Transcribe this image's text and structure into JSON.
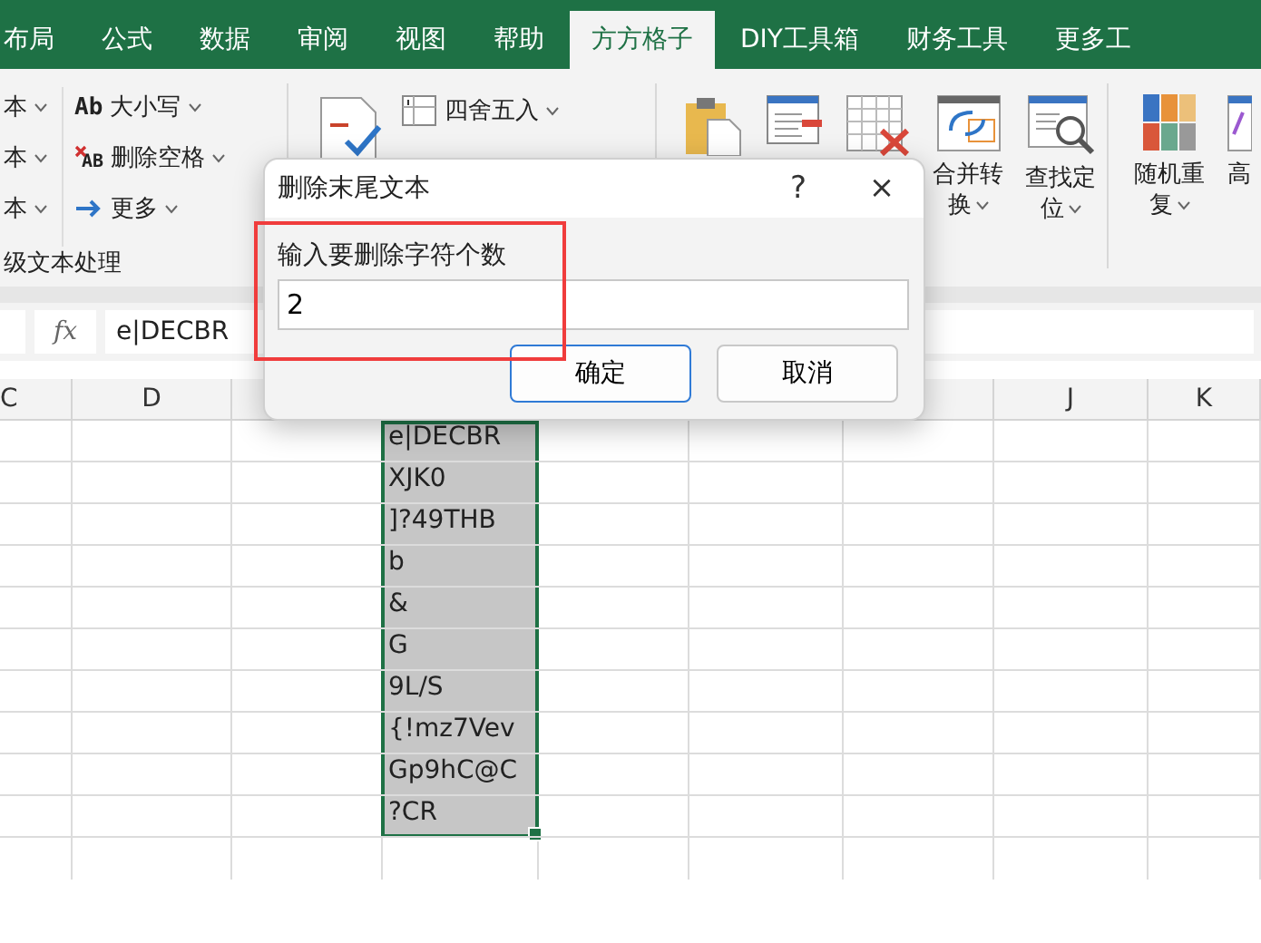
{
  "tabs": [
    {
      "label": "布局",
      "selected": false
    },
    {
      "label": "公式",
      "selected": false
    },
    {
      "label": "数据",
      "selected": false
    },
    {
      "label": "审阅",
      "selected": false
    },
    {
      "label": "视图",
      "selected": false
    },
    {
      "label": "帮助",
      "selected": false
    },
    {
      "label": "方方格子",
      "selected": true
    },
    {
      "label": "DIY工具箱",
      "selected": false
    },
    {
      "label": "财务工具",
      "selected": false
    },
    {
      "label": "更多工",
      "selected": false
    }
  ],
  "ribbon": {
    "cut_items": [
      "本",
      "本",
      "本"
    ],
    "text_tools": [
      {
        "kind": "case",
        "icon_text": "Ab",
        "label": "大小写"
      },
      {
        "kind": "trim",
        "icon_text": "AB",
        "label": "删除空格"
      },
      {
        "kind": "more",
        "label": "更多"
      }
    ],
    "group_label": "级文本处理",
    "round_label": "四舍五入",
    "big_buttons": [
      {
        "kind": "clipboard"
      },
      {
        "kind": "form"
      },
      {
        "kind": "grid-delete"
      },
      {
        "kind": "merge",
        "lines": [
          "合并转",
          "换"
        ]
      },
      {
        "kind": "find",
        "lines": [
          "查找定",
          "位"
        ]
      }
    ],
    "right_buttons": [
      {
        "kind": "color-grid",
        "lines": [
          "随机重",
          "复"
        ]
      },
      {
        "kind": "chart",
        "lines": [
          "高"
        ]
      }
    ]
  },
  "formula_bar": {
    "function_label": "fx",
    "value": "e|DECBR"
  },
  "headers": {
    "left": [
      "C",
      "D"
    ],
    "right": [
      "J",
      "K"
    ]
  },
  "cells": {
    "selected": true,
    "values": [
      "e|DECBR",
      "XJK0",
      "]?49THB",
      "b",
      "&",
      "G",
      "9L/S",
      "{!mz7Vev",
      "Gp9hC@C",
      "?CR"
    ]
  },
  "dialog": {
    "title": "删除末尾文本",
    "help": "?",
    "close": "×",
    "label": "输入要删除字符个数",
    "value": "2",
    "buttons": [
      {
        "label": "确定",
        "default": true
      },
      {
        "label": "取消",
        "default": false
      }
    ]
  }
}
